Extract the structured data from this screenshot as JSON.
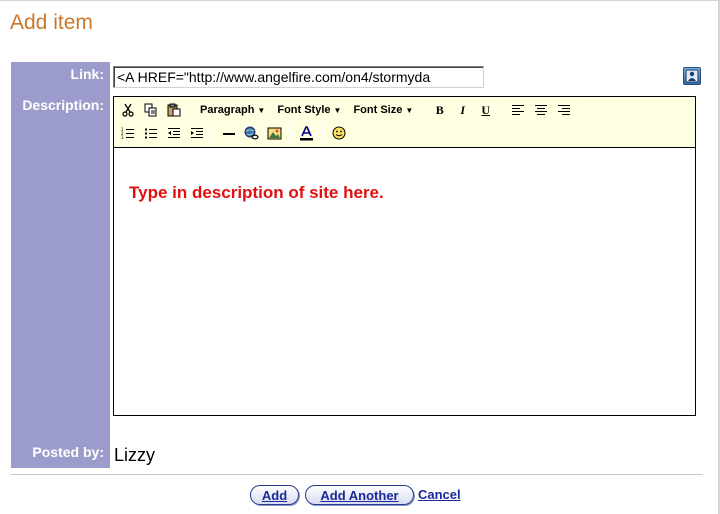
{
  "page": {
    "title": "Add item"
  },
  "form": {
    "link_label": "Link:",
    "link_value": "<A HREF=\"http://www.angelfire.com/on4/stormyda",
    "description_label": "Description:",
    "description_text": "Type in description of site here.",
    "posted_by_label": "Posted by:",
    "posted_by_value": "Lizzy"
  },
  "toolbar": {
    "paragraph_label": "Paragraph",
    "font_style_label": "Font Style",
    "font_size_label": "Font Size",
    "bold_label": "B",
    "italic_label": "I",
    "underline_label": "U"
  },
  "actions": {
    "add_label": "Add",
    "add_another_label": "Add Another",
    "cancel_label": "Cancel"
  },
  "colors": {
    "title": "#c8782c",
    "label_column": "#9c9ccc",
    "toolbar_bg": "#ffffe1",
    "placeholder_text": "#e01010",
    "link_blue": "#1a2a9a"
  }
}
